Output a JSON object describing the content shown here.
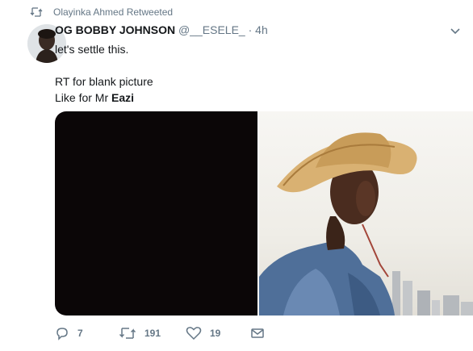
{
  "retweet_context": {
    "icon": "retweet-icon",
    "text": "Olayinka Ahmed Retweeted"
  },
  "author": {
    "name": "OG BOBBY JOHNSON",
    "handle": "@__ESELE_",
    "separator": "·",
    "time": "4h"
  },
  "tweet": {
    "line1": "let's settle this.",
    "line2": "RT for blank picture",
    "line3_prefix": "Like for Mr ",
    "line3_bold": "Eazi"
  },
  "actions": {
    "reply_count": "7",
    "retweet_count": "191",
    "like_count": "19"
  },
  "colors": {
    "muted": "#657786",
    "text": "#14171a",
    "blank_image": "#0b0607"
  },
  "icons": [
    "retweet-icon",
    "chevron-down-icon",
    "reply-icon",
    "like-icon",
    "direct-message-icon"
  ]
}
